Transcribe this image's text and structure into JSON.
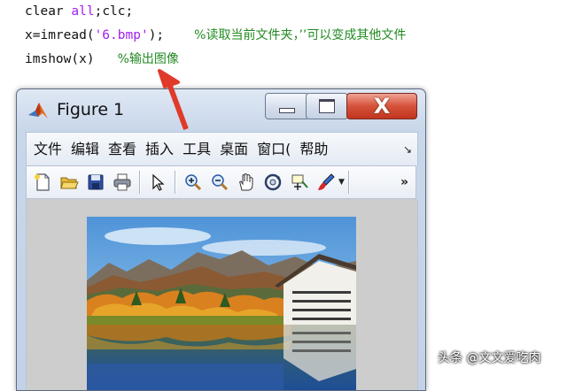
{
  "code": {
    "line1": {
      "kw": "clear ",
      "arg": "all",
      "rest": ";clc;"
    },
    "line2": {
      "pre": "x=imread(",
      "str": "'6.bmp'",
      "post": ");",
      "comment": "%读取当前文件夹，’’可以变成其他文件"
    },
    "line3": {
      "code": "imshow(x)",
      "comment": "%输出图像"
    }
  },
  "figure": {
    "title": "Figure 1",
    "close_label": "X",
    "menu": [
      "文件",
      "编辑",
      "查看",
      "插入",
      "工具",
      "桌面",
      "窗口(",
      "帮助"
    ],
    "menu_overflow": "↘",
    "toolbar_overflow": "»",
    "toolbar_icons": [
      "new-figure-icon",
      "open-file-icon",
      "save-icon",
      "print-icon",
      "select-arrow-icon",
      "zoom-in-icon",
      "zoom-out-icon",
      "pan-hand-icon",
      "rotate-3d-icon",
      "data-cursor-icon",
      "brush-icon"
    ]
  },
  "watermark": "头条 @文文爱吃肉",
  "colors": {
    "comment": "#228b22",
    "string": "#a020f0",
    "arrow": "#e03a2a",
    "close": "#c2351f"
  }
}
